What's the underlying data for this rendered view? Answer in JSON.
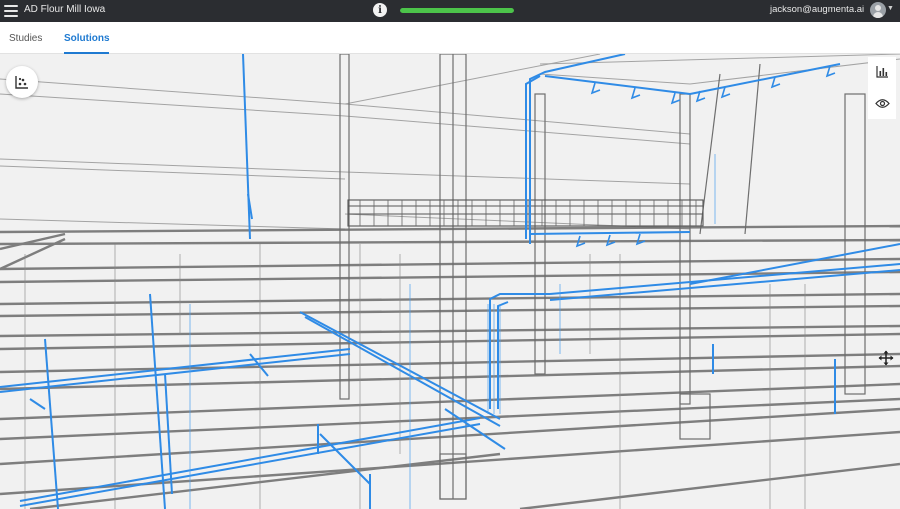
{
  "header": {
    "app_title": "AD Flour Mill Iowa",
    "info_label": "i",
    "progress_fraction": 1.0,
    "user_email": "jackson@augmenta.ai"
  },
  "tabs": [
    {
      "label": "Studies",
      "active": false
    },
    {
      "label": "Solutions",
      "active": true
    }
  ],
  "toolbar": {
    "left_fab_icon": "scatter-chart-icon",
    "right_icons": [
      "bar-chart-icon",
      "eye-icon"
    ],
    "move_icon": "move-arrows-icon"
  },
  "colors": {
    "topbar": "#2b2d31",
    "accent_blue": "#1f7ad1",
    "pipe_blue": "#2f8be6",
    "progress_green": "#4cc44a",
    "structure_gray": "#6e6e6e"
  }
}
